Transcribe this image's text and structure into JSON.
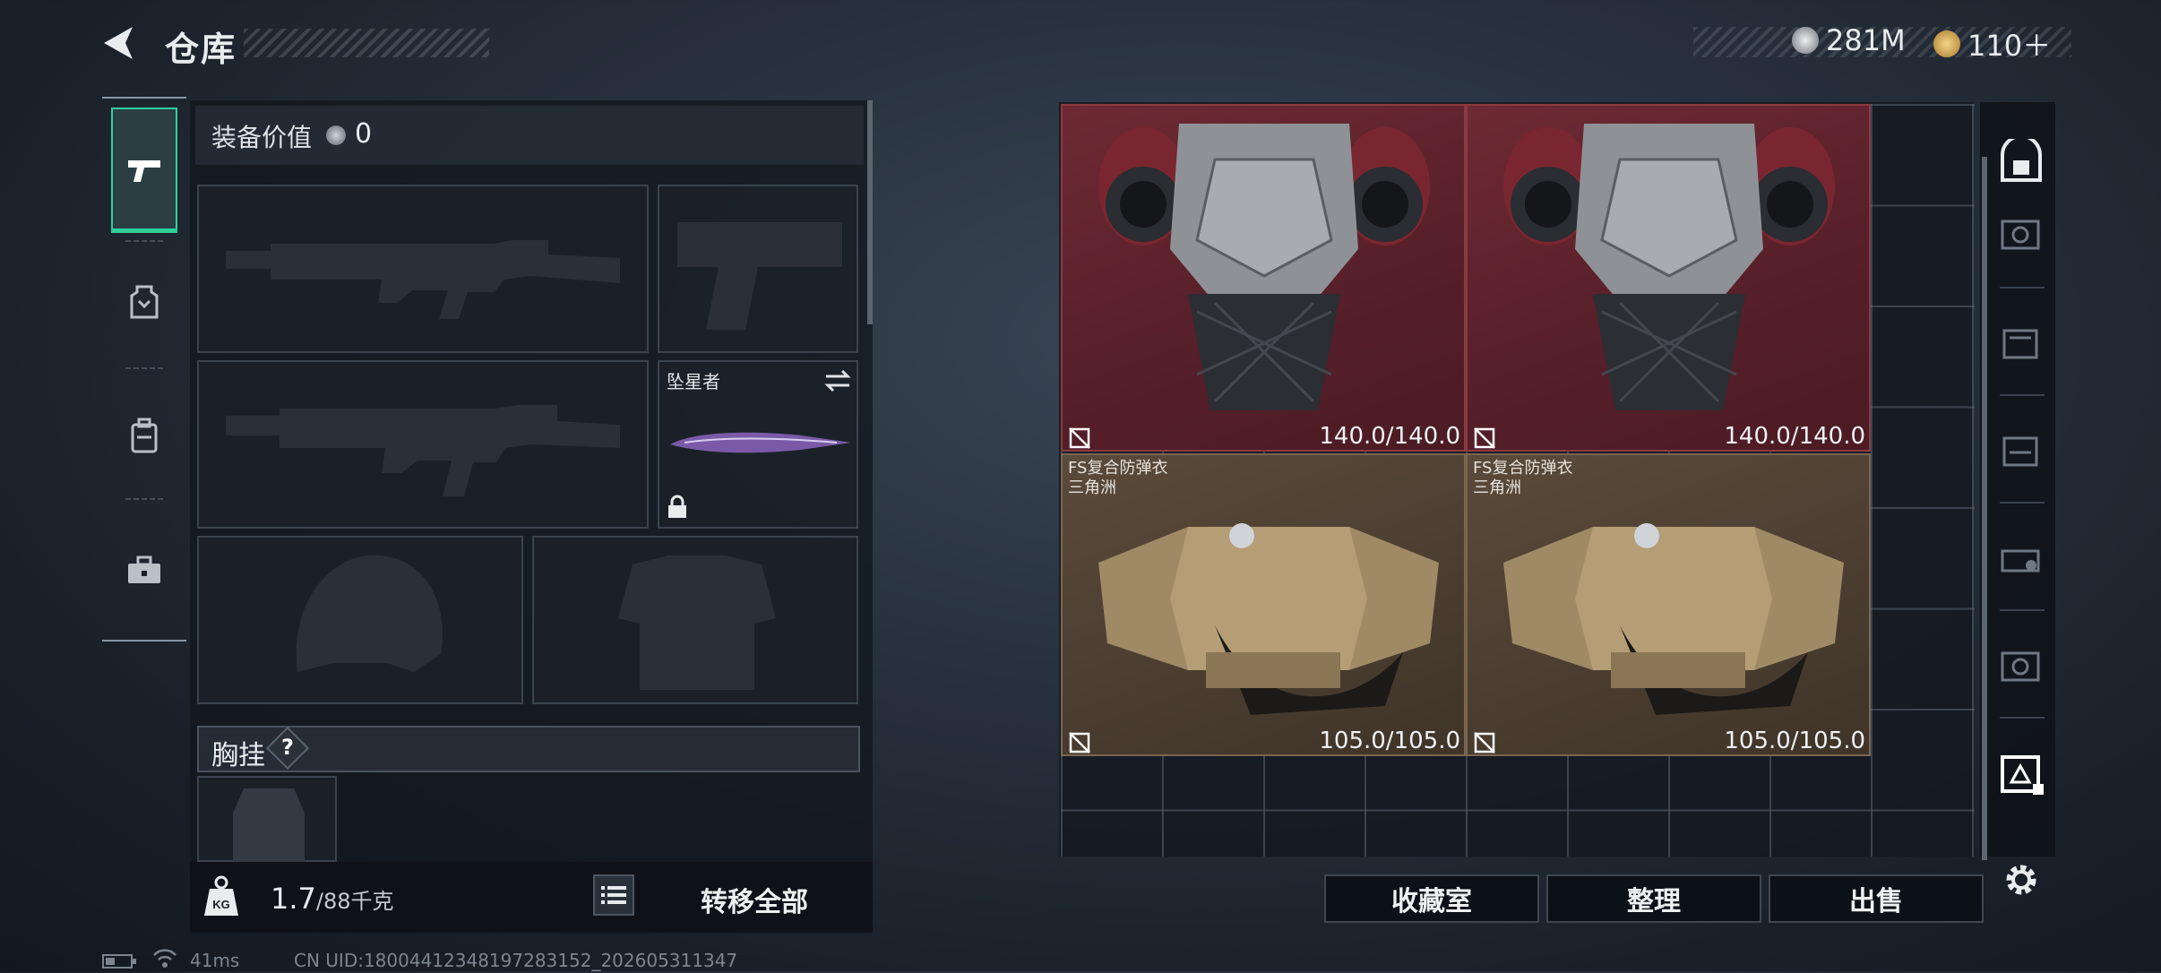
{
  "header": {
    "title": "仓库",
    "currency1": "281M",
    "currency2": "110＋"
  },
  "nav": {
    "tabs": [
      "weapons-tab",
      "armor-tab",
      "backpack-tab",
      "toolbox-tab"
    ]
  },
  "loadout": {
    "value_label": "装备价值",
    "value": "0",
    "melee_name": "坠星者",
    "chest_label": "胸挂",
    "chest_help": "?",
    "weight_current": "1.7",
    "weight_max": "/88千克",
    "transfer_all": "转移全部"
  },
  "storage": {
    "items": [
      {
        "durability": "140.0/140.0",
        "name": "",
        "subtitle": ""
      },
      {
        "durability": "140.0/140.0",
        "name": "",
        "subtitle": ""
      },
      {
        "durability": "105.0/105.0",
        "name": "FS复合防弹衣",
        "subtitle": "三角洲"
      },
      {
        "durability": "105.0/105.0",
        "name": "FS复合防弹衣",
        "subtitle": "三角洲"
      }
    ],
    "buttons": {
      "collection": "收藏室",
      "sort": "整理",
      "sell": "出售"
    }
  },
  "status": {
    "ping": "41ms",
    "uid": "CN UID:1800441234819728315​2_202605311347"
  },
  "colors": {
    "accent": "#2fd09a",
    "red_rarity": "#6e2a33",
    "tan_rarity": "#5a4a3a"
  }
}
